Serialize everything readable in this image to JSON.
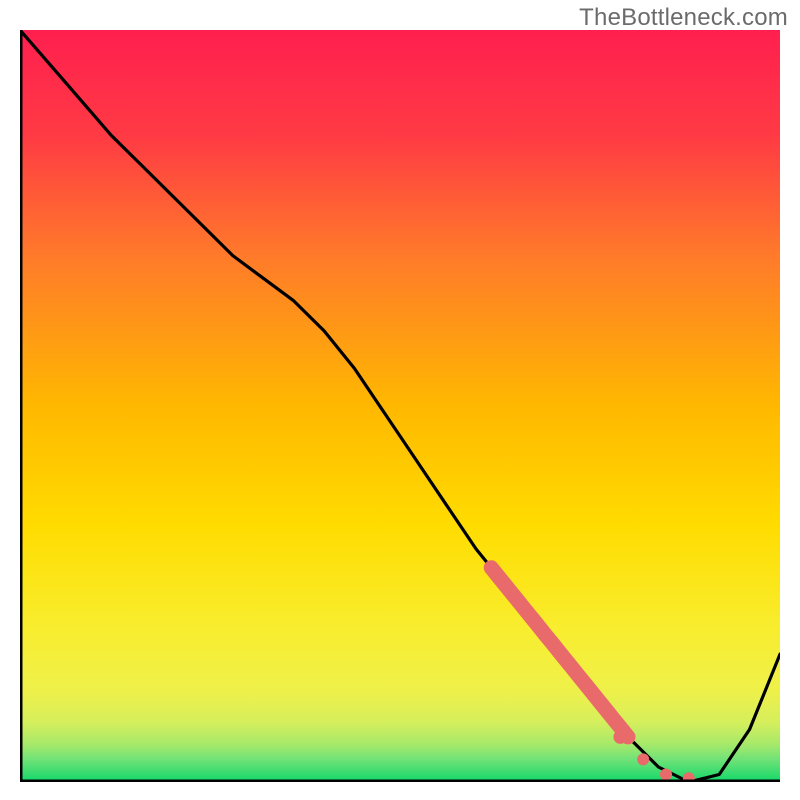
{
  "watermark": "TheBottleneck.com",
  "chart_data": {
    "type": "line",
    "title": "",
    "xlabel": "",
    "ylabel": "",
    "xlim": [
      0,
      100
    ],
    "ylim": [
      0,
      100
    ],
    "grid": false,
    "legend": "none",
    "background_gradient": {
      "top": "#ff1f4f",
      "upper_mid": "#ff7a2a",
      "mid": "#ffd200",
      "lower_mid": "#f4ef4a",
      "band1": "#b8ed63",
      "band2": "#72e37a",
      "bottom": "#12d86a"
    },
    "series": [
      {
        "name": "curve",
        "color": "#000000",
        "x": [
          0,
          6,
          12,
          18,
          24,
          28,
          32,
          36,
          40,
          44,
          48,
          52,
          56,
          60,
          64,
          68,
          72,
          76,
          80,
          82,
          84,
          86,
          88,
          92,
          96,
          100
        ],
        "y": [
          100,
          93,
          86,
          80,
          74,
          70,
          67,
          64,
          60,
          55,
          49,
          43,
          37,
          31,
          26,
          21,
          16,
          11,
          6,
          4,
          2,
          1,
          0,
          1,
          7,
          17
        ]
      }
    ],
    "highlight_segment": {
      "name": "highlight",
      "color": "#e96a6a",
      "x_range": [
        62,
        80
      ],
      "thickness": "thick"
    },
    "highlight_points": [
      {
        "x": 79,
        "y": 6
      },
      {
        "x": 82,
        "y": 3
      },
      {
        "x": 85,
        "y": 1
      },
      {
        "x": 88,
        "y": 0.5
      }
    ]
  }
}
